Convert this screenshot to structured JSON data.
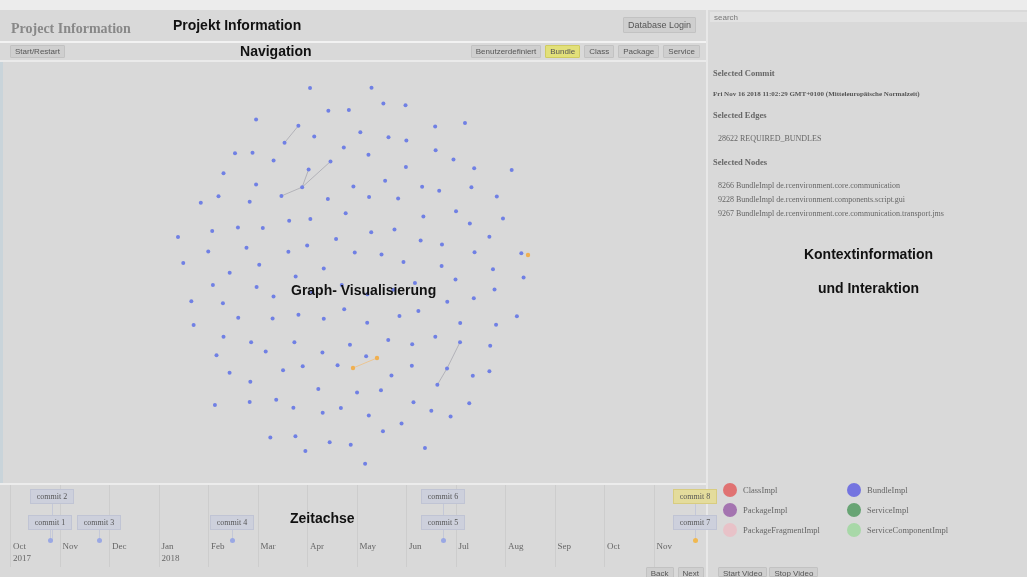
{
  "header": {
    "title": "Project Information",
    "annotation": "Projekt Information",
    "login_button": "Database Login"
  },
  "toolbar": {
    "restart_button": "Start/Restart",
    "annotation": "Navigation",
    "filters": [
      {
        "label": "Benutzerdefiniert",
        "selected": false
      },
      {
        "label": "Bundle",
        "selected": true
      },
      {
        "label": "Class",
        "selected": false
      },
      {
        "label": "Package",
        "selected": false
      },
      {
        "label": "Service",
        "selected": false
      }
    ]
  },
  "graph": {
    "annotation": "Graph- Visualisierung"
  },
  "timeline": {
    "annotation": "Zeitachse",
    "commits": [
      {
        "label": "commit 2",
        "selected": false
      },
      {
        "label": "commit 6",
        "selected": false
      },
      {
        "label": "commit 8",
        "selected": true
      },
      {
        "label": "commit 1",
        "selected": false
      },
      {
        "label": "commit 3",
        "selected": false
      },
      {
        "label": "commit 4",
        "selected": false
      },
      {
        "label": "commit 5",
        "selected": false
      },
      {
        "label": "commit 7",
        "selected": false
      }
    ],
    "months": [
      {
        "label": "Oct",
        "year": "2017"
      },
      {
        "label": "Nov"
      },
      {
        "label": "Dec"
      },
      {
        "label": "Jan",
        "year": "2018"
      },
      {
        "label": "Feb"
      },
      {
        "label": "Mar"
      },
      {
        "label": "Apr"
      },
      {
        "label": "May"
      },
      {
        "label": "Jun"
      },
      {
        "label": "Jul"
      },
      {
        "label": "Aug"
      },
      {
        "label": "Sep"
      },
      {
        "label": "Oct"
      },
      {
        "label": "Nov"
      }
    ],
    "back_button": "Back",
    "next_button": "Next"
  },
  "context": {
    "search": {
      "placeholder": "search"
    },
    "sections": [
      {
        "heading": "Selected Commit",
        "value": "Fri Nov 16 2018 11:02:29 GMT+0100 (Mitteleuropäische Normalzeit)"
      },
      {
        "heading": "Selected Edges",
        "items": [
          "28622 REQUIRED_BUNDLES"
        ]
      },
      {
        "heading": "Selected Nodes",
        "items": [
          "8266 BundleImpl de.rcenvironment.core.communication",
          "9228 BundleImpl de.rcenvironment.components.script.gui",
          "9267 BundleImpl de.rcenvironment.core.communication.transport.jms"
        ]
      }
    ],
    "annotation_lines": [
      "Kontextinformation",
      "und Interaktion"
    ],
    "legend": [
      {
        "label": "ClassImpl",
        "color": "#e07272"
      },
      {
        "label": "BundleImpl",
        "color": "#7474e0"
      },
      {
        "label": "PackageImpl",
        "color": "#a474b0"
      },
      {
        "label": "ServiceImpl",
        "color": "#68a474"
      },
      {
        "label": "PackageFragmentImpl",
        "color": "#e8c2c8"
      },
      {
        "label": "ServiceComponentImpl",
        "color": "#a8d8a8"
      }
    ],
    "video_buttons": [
      "Start Video",
      "Stop Video"
    ]
  }
}
